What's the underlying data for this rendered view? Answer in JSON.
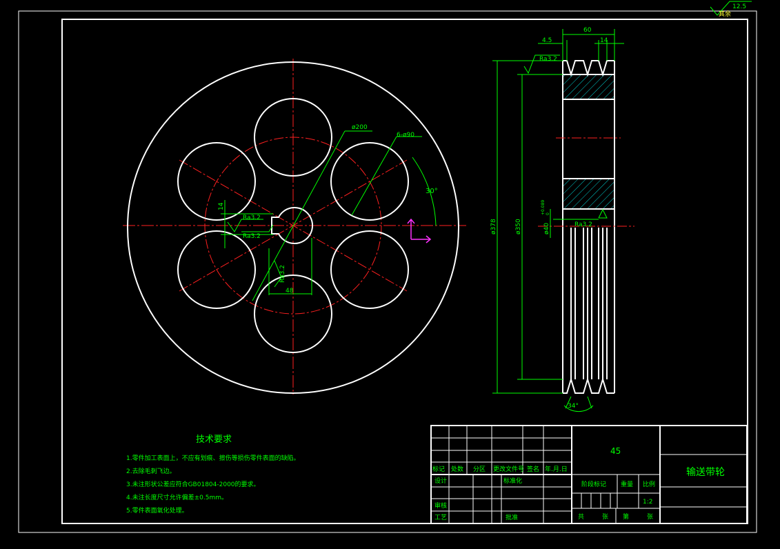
{
  "roughness": {
    "value": "12.5",
    "label": "其余"
  },
  "front_view": {
    "dims": {
      "pitch_circle": "ø200",
      "holes": "6-ø90",
      "angle": "30°",
      "keyway_height": "14",
      "bore_ra_top": "Ra3.2",
      "bore_ra_bottom": "Ra3.2",
      "keyway_ra": "Ra3.2",
      "keyway_width": "48"
    }
  },
  "side_view": {
    "dims": {
      "width": "60",
      "offset": "4.5",
      "groove_pitch": "14",
      "rim_ra": "Ra3.2",
      "outer_dia": "ø378",
      "pitch_dia": "ø350",
      "bore_dia": "ø40",
      "bore_tol_upper": "+0.089",
      "bore_tol_lower": "0",
      "bore_ra": "Ra3.2",
      "groove_angle": "34°"
    }
  },
  "notes": {
    "title": "技术要求",
    "items": [
      "1.零件加工表面上，不应有划痕、擦伤等损伤零件表面的缺陷。",
      "2.去除毛刺飞边。",
      "3.未注形状公差应符合GB01804-2000的要求。",
      "4.未注长度尺寸允许偏差±0.5mm。",
      "5.零件表面氧化处理。"
    ]
  },
  "title_block": {
    "material": "45",
    "part_name": "输送带轮",
    "headers": [
      "标记",
      "处数",
      "分区",
      "更改文件号",
      "签名",
      "年.月.日"
    ],
    "design": "设计",
    "standardize": "标准化",
    "review": "审核",
    "process": "工艺",
    "approve": "批准",
    "stage_mark": "阶段标记",
    "weight": "重量",
    "scale_label": "比例",
    "scale_value": "1:2",
    "total": "共",
    "sheets": "张",
    "number": "第"
  }
}
